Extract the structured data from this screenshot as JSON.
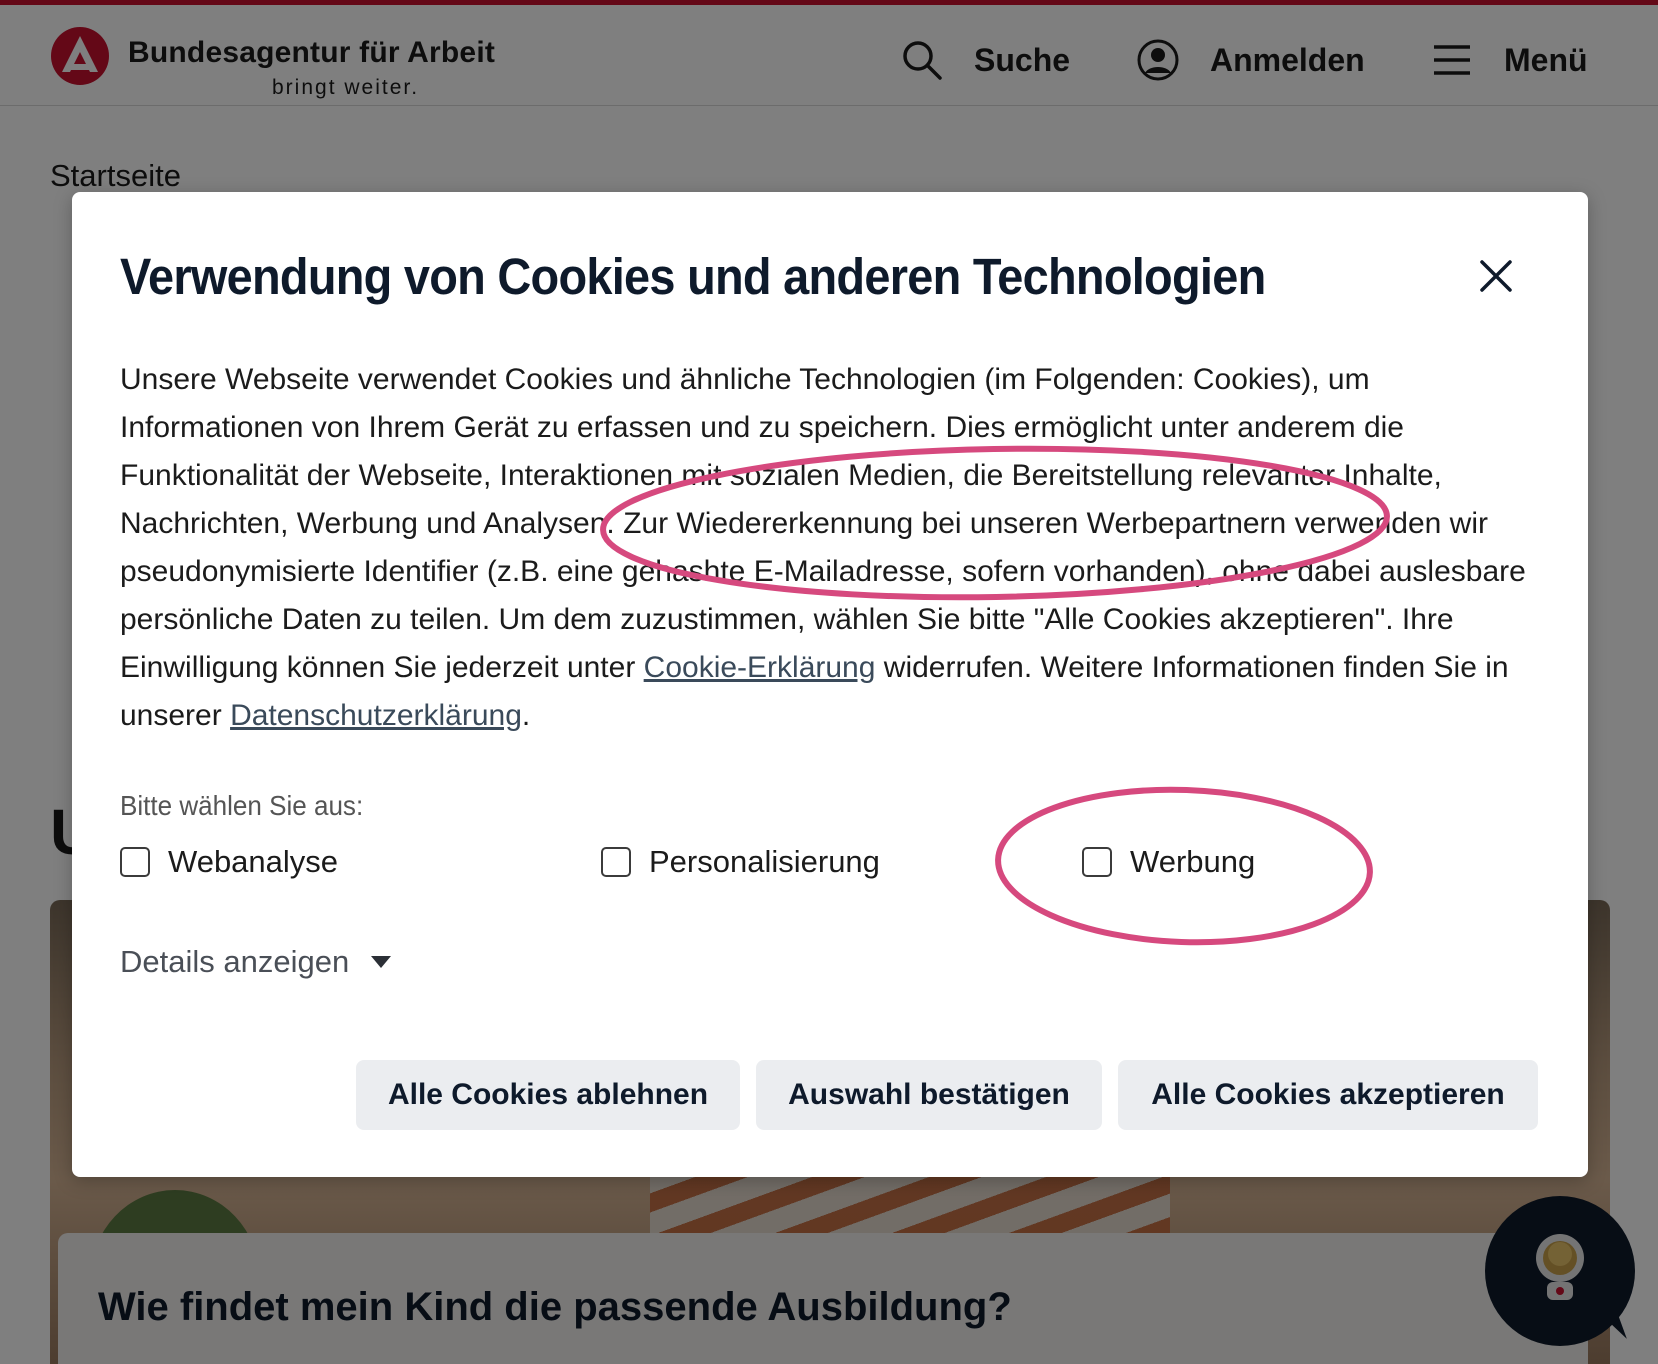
{
  "header": {
    "brand_name": "Bundesagentur für Arbeit",
    "brand_claim": "bringt weiter.",
    "nav": {
      "search_label": "Suche",
      "login_label": "Anmelden",
      "menu_label": "Menü"
    },
    "accent_color": "#c8102e"
  },
  "page": {
    "breadcrumb": "Startseite",
    "heading_partial": "U",
    "teaser_title": "Wie findet mein Kind die passende Ausbildung?"
  },
  "cookie_modal": {
    "title": "Verwendung von Cookies und anderen Technologien",
    "close_icon": "close-icon",
    "text": {
      "part1": "Unsere Webseite verwendet Cookies und ähnliche Technologien (im Folgenden: Cookies), um Informationen von Ihrem Gerät zu erfassen und zu speichern. Dies ermöglicht unter anderem die Funktionalität der Webseite, Interaktionen mit sozialen Medien, die Bereitstellung relevanter Inhalte, Nachrichten, Werbung und Analysen. Zur Wiedererkennung bei unseren Werbepartnern verwenden wir pseudonymisierte Identifier (z.B. eine gehashte E-Mailadresse, sofern vorhanden), ohne dabei auslesbare persönliche Daten zu teilen. Um dem zuzustimmen, wählen Sie bitte \"Alle Cookies akzeptieren\". Ihre Einwilligung können Sie jederzeit unter ",
      "link1": "Cookie-Erklärung",
      "part2": " widerrufen. Weitere Informationen finden Sie in unserer ",
      "link2": "Datenschutzerklärung",
      "part3": "."
    },
    "select_label": "Bitte wählen Sie aus:",
    "options": [
      {
        "label": "Webanalyse",
        "checked": false
      },
      {
        "label": "Personalisierung",
        "checked": false
      },
      {
        "label": "Werbung",
        "checked": false
      }
    ],
    "details_label": "Details anzeigen",
    "buttons": {
      "reject": "Alle Cookies ablehnen",
      "confirm": "Auswahl bestätigen",
      "accept": "Alle Cookies akzeptieren"
    }
  },
  "annotation_color": "#d6497e"
}
